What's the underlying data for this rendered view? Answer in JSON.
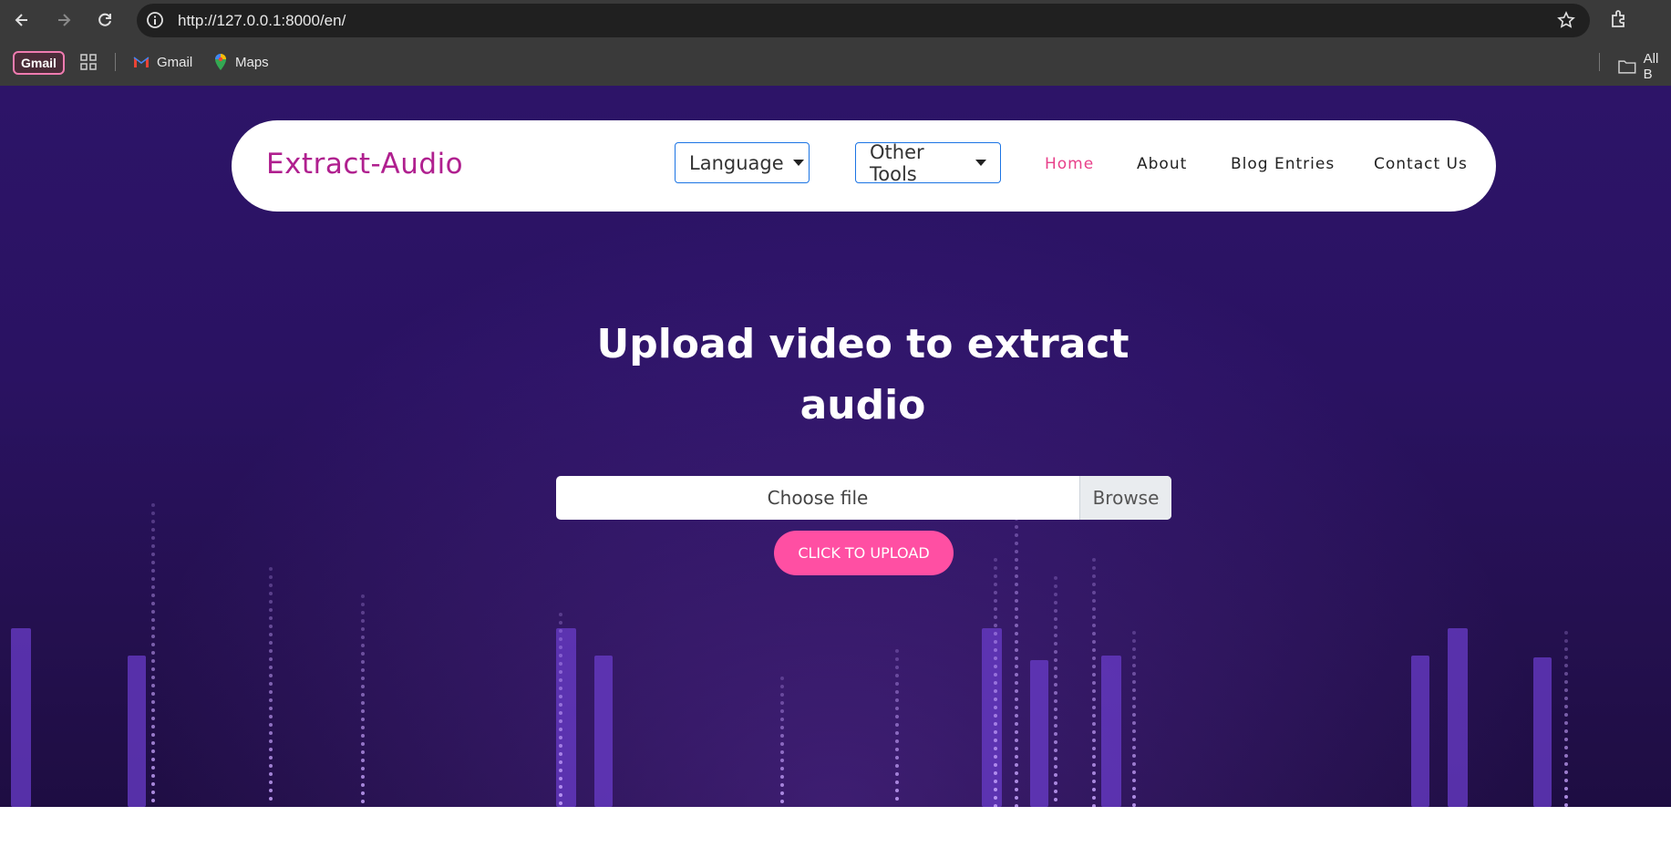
{
  "browser": {
    "url": "http://127.0.0.1:8000/en/",
    "bookmarks": {
      "gmail_chip": "Gmail",
      "items": [
        {
          "label": "Gmail",
          "icon": "gmail-icon"
        },
        {
          "label": "Maps",
          "icon": "maps-icon"
        }
      ],
      "folder_label": "All B"
    }
  },
  "navbar": {
    "brand": "Extract-Audio",
    "language_label": "Language",
    "tools_label": "Other Tools",
    "links": [
      "Home",
      "About",
      "Blog Entries",
      "Contact Us"
    ],
    "active_link": "Home"
  },
  "hero": {
    "headline_line1": "Upload video to extract",
    "headline_line2": "audio",
    "file_placeholder": "Choose file",
    "browse_label": "Browse",
    "upload_label": "CLICK TO UPLOAD"
  },
  "colors": {
    "brand": "#b0208f",
    "accent_pink": "#ff4fa3",
    "active_link": "#e8408a",
    "dropdown_border": "#1b74e4",
    "hero_bg": "#2a1262"
  }
}
